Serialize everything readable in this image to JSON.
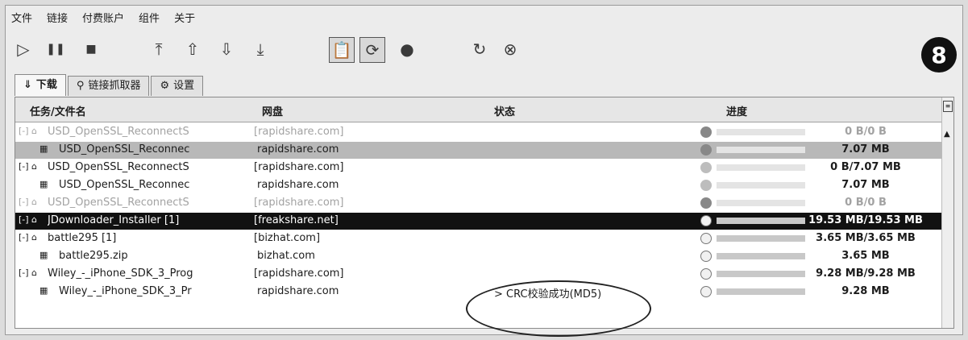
{
  "menu": [
    "文件",
    "链接",
    "付费账户",
    "组件",
    "关于"
  ],
  "toolbar_icons": [
    "play-icon",
    "pause-icon",
    "stop-icon",
    "move-top-icon",
    "move-up-icon",
    "move-down-icon",
    "move-bottom-icon",
    "clipboard-monitor-icon",
    "reconnect-toggle-icon",
    "premium-icon",
    "update-icon",
    "reconnect-icon"
  ],
  "badge": "8",
  "tabs": [
    "下载",
    "链接抓取器",
    "设置"
  ],
  "columns": {
    "name": "任务/文件名",
    "host": "网盘",
    "status": "状态",
    "progress": "进度"
  },
  "rows": [
    {
      "name": "USD_OpenSSL_ReconnectS",
      "host": "[rapidshare.com]",
      "status": "",
      "progress": "0 B/0 B",
      "fraction": 0,
      "style": "dim"
    },
    {
      "name": "USD_OpenSSL_Reconnec",
      "host": "rapidshare.com",
      "status": "",
      "progress": "7.07 MB",
      "fraction": 0,
      "style": "hilite"
    },
    {
      "name": "USD_OpenSSL_ReconnectS",
      "host": "[rapidshare.com]",
      "status": "",
      "progress": "0 B/7.07 MB",
      "fraction": 0,
      "style": "normal"
    },
    {
      "name": "USD_OpenSSL_Reconnec",
      "host": "rapidshare.com",
      "status": "",
      "progress": "7.07 MB",
      "fraction": 0,
      "style": "normal"
    },
    {
      "name": "USD_OpenSSL_ReconnectS",
      "host": "[rapidshare.com]",
      "status": "",
      "progress": "0 B/0 B",
      "fraction": 0,
      "style": "dim"
    },
    {
      "name": "JDownloader_Installer [1]",
      "host": "[freakshare.net]",
      "status": "",
      "progress": "19.53 MB/19.53 MB",
      "fraction": 1,
      "style": "selected"
    },
    {
      "name": "battle295 [1]",
      "host": "[bizhat.com]",
      "status": "",
      "progress": "3.65 MB/3.65 MB",
      "fraction": 1,
      "style": "normal"
    },
    {
      "name": "battle295.zip",
      "host": "bizhat.com",
      "status": "",
      "progress": "3.65 MB",
      "fraction": 1,
      "style": "normal"
    },
    {
      "name": "Wiley_-_iPhone_SDK_3_Prog",
      "host": "[rapidshare.com]",
      "status": "",
      "progress": "9.28 MB/9.28 MB",
      "fraction": 1,
      "style": "normal"
    },
    {
      "name": "Wiley_-_iPhone_SDK_3_Pr",
      "host": "rapidshare.com",
      "status": "> CRC校验成功(MD5)",
      "progress": "9.28 MB",
      "fraction": 1,
      "style": "normal"
    }
  ],
  "row_kind": [
    "package",
    "file",
    "package",
    "file",
    "package",
    "package",
    "package",
    "file",
    "package",
    "file"
  ]
}
